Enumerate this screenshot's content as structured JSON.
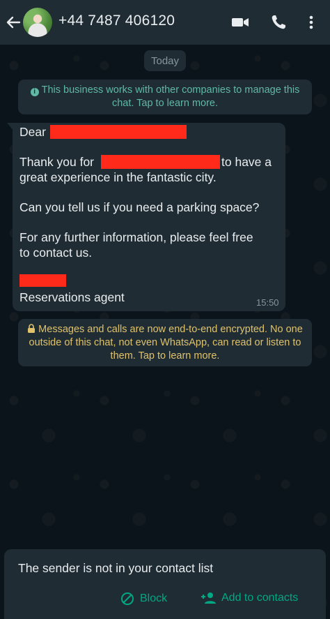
{
  "header": {
    "phone_number": "+44 7487 406120"
  },
  "chat": {
    "date_label": "Today",
    "business_notice": "This business works with other companies to manage this chat. Tap to learn more.",
    "message": {
      "greeting": "Dear",
      "line_thank_prefix": "Thank you for",
      "line_thank_suffix": "to have a",
      "line_experience": "great experience in the fantastic city.",
      "line_parking": "Can you tell us if you need a parking space?",
      "line_further_1": "For any further information, please feel free",
      "line_further_2": "to contact us.",
      "signature_role": "Reservations agent",
      "time": "15:50"
    },
    "encryption_notice": "Messages and calls are now end-to-end encrypted. No one outside of this chat, not even WhatsApp, can read or listen to them. Tap to learn more."
  },
  "contact_card": {
    "notice": "The sender is not in your contact list",
    "block_label": "Block",
    "add_label": "Add to contacts"
  },
  "colors": {
    "background": "#0b141a",
    "panel": "#1f2c34",
    "accent_green": "#00a884",
    "notice_teal": "#5fb9a4",
    "notice_yellow": "#e0c26a",
    "redaction": "#ff2a1a"
  }
}
